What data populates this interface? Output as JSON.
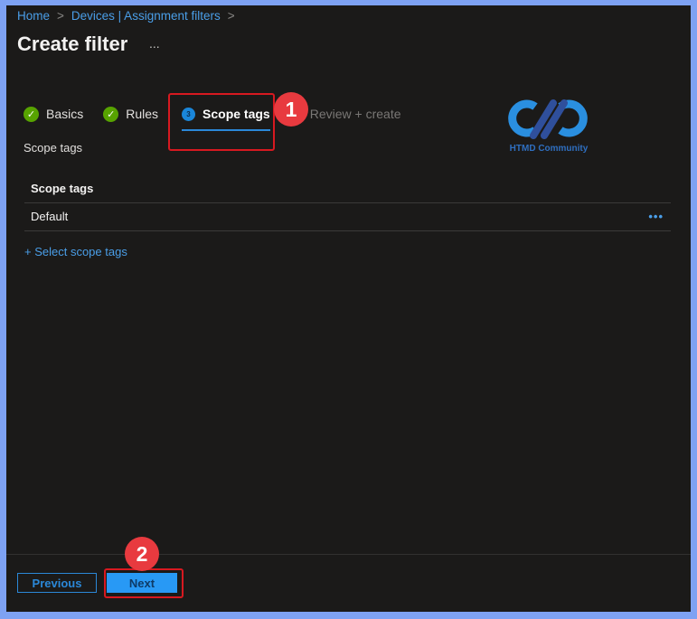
{
  "breadcrumb": {
    "items": [
      "Home",
      "Devices | Assignment filters"
    ],
    "separator": ">"
  },
  "header": {
    "title": "Create filter",
    "more": "..."
  },
  "tabs": [
    {
      "label": "Basics",
      "state": "completed",
      "icon": "check-icon"
    },
    {
      "label": "Rules",
      "state": "completed",
      "icon": "check-icon"
    },
    {
      "label": "Scope tags",
      "state": "active",
      "step": "3"
    },
    {
      "label": "Review + create",
      "state": "disabled"
    }
  ],
  "section_label": "Scope tags",
  "table": {
    "header": "Scope tags",
    "rows": [
      {
        "name": "Default",
        "more": "•••"
      }
    ]
  },
  "add_link": "+ Select scope tags",
  "logo": {
    "text": "HTMD Community"
  },
  "footer": {
    "previous": "Previous",
    "next": "Next"
  },
  "annotations": {
    "badge1": "1",
    "badge2": "2",
    "color": "#e83a3f"
  },
  "colors": {
    "accent": "#2899f5",
    "link": "#4a9ee8",
    "success": "#57a300",
    "background": "#1b1a19"
  }
}
